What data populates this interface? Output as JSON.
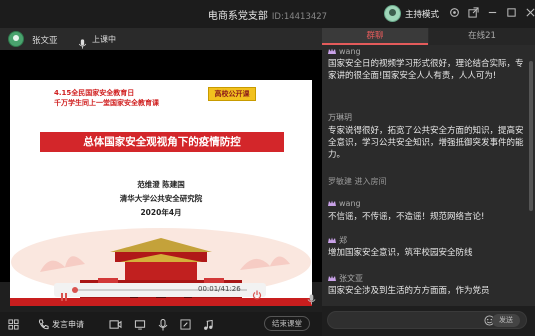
{
  "window": {
    "title": "电商系党支部",
    "id_text": "ID:14413427",
    "host_mode_label": "主持模式"
  },
  "presenter": {
    "name": "张文亚",
    "status": "上课中"
  },
  "slide": {
    "line1": "4.15全民国家安全教育日",
    "line2": "千万学生同上一堂国家安全教育课",
    "badge": "高校公开课",
    "banner": "总体国家安全观视角下的疫情防控",
    "authors": "范维澄    陈建国",
    "institution": "清华大学公共安全研究院",
    "date": "2020年4月"
  },
  "player": {
    "time": "00:01/41:26",
    "progress": 0.0004
  },
  "bottombar": {
    "speak_request": "发言申请",
    "end_class": "结束课堂"
  },
  "panel": {
    "tab_group": "群聊",
    "tab_online": "在线21",
    "send_label": "发送"
  },
  "messages": [
    {
      "name": "wang",
      "text": "国家安全日的视频学习形式很好，理论结合实际，专家讲的很全面!国家安全人人有责，人人可为!"
    },
    {
      "name": "万琳玥",
      "text": "专家说得很好，拓宽了公共安全方面的知识，提高安全意识，学习公共安全知识，增强抵御突发事件的能力。"
    },
    {
      "system": "罗敏建 进入房间"
    },
    {
      "name": "wang",
      "text": "不信谣，不传谣，不造谣！规范网络言论!"
    },
    {
      "name": "郑",
      "text": "增加国家安全意识，筑牢校园安全防线"
    },
    {
      "name": "张文亚",
      "text": "国家安全涉及到生活的方方面面，作为党员"
    }
  ],
  "colors": {
    "accent": "#e45b5b",
    "banner_red": "#d3262a",
    "badge_yellow": "#f2c11e"
  }
}
